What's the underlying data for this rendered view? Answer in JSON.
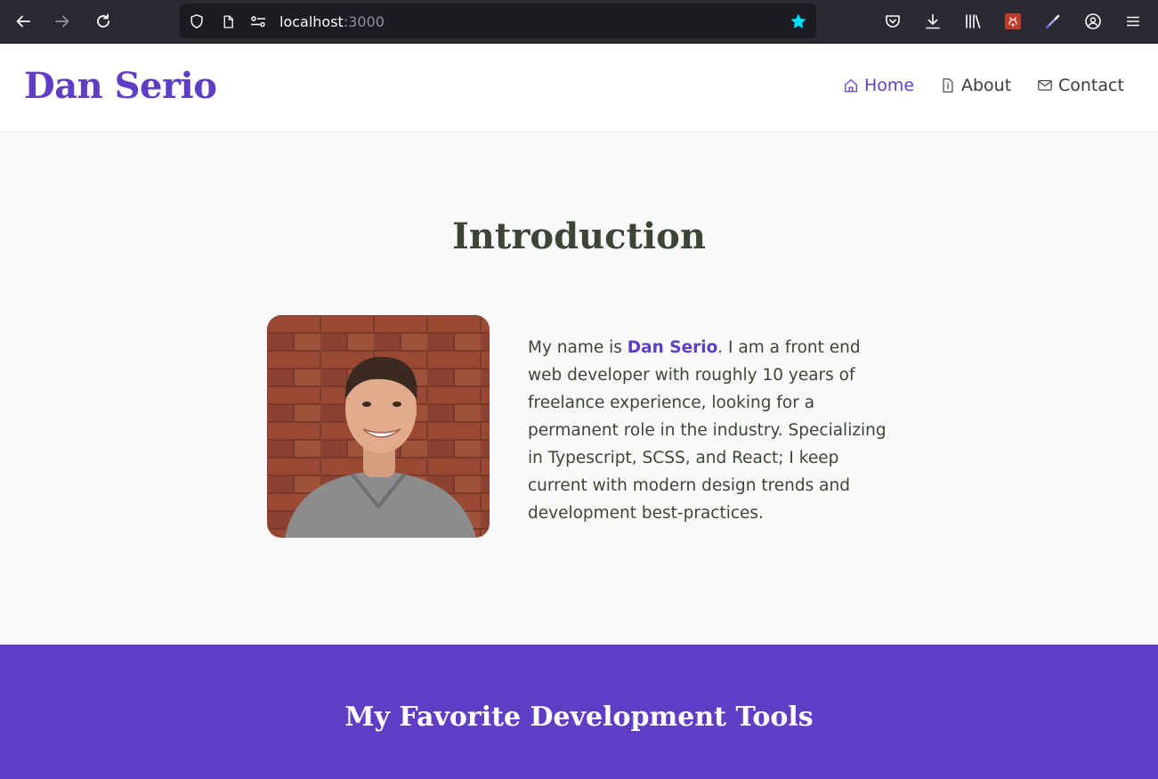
{
  "browser": {
    "url_host": "localhost",
    "url_port": ":3000",
    "icons": {
      "back": "back-arrow-icon",
      "forward": "forward-arrow-icon",
      "reload": "reload-icon",
      "shield": "tracking-protection-shield-icon",
      "page": "page-info-icon",
      "permissions": "permissions-icon",
      "bookmark": "bookmark-star-icon",
      "pocket": "pocket-icon",
      "downloads": "download-icon",
      "library": "library-icon",
      "extension1": "extension-icon",
      "extension2": "eyedropper-icon",
      "sync": "account-sync-icon",
      "menu": "hamburger-menu-icon"
    },
    "accent": "#00ddff"
  },
  "site": {
    "logo": "Dan Serio",
    "brand_color": "#5f3dc4",
    "nav": [
      {
        "label": "Home",
        "icon": "home-icon",
        "active": true
      },
      {
        "label": "About",
        "icon": "document-icon",
        "active": false
      },
      {
        "label": "Contact",
        "icon": "mail-icon",
        "active": false
      }
    ]
  },
  "intro": {
    "title": "Introduction",
    "text_before": "My name is ",
    "name": "Dan Serio",
    "text_after": ". I am a front end web developer with roughly 10 years of freelance experience, looking for a permanent role in the industry. Specializing in Typescript, SCSS, and React; I keep current with modern design trends and development best-practices.",
    "photo": "profile-photo"
  },
  "tools": {
    "title": "My Favorite Development Tools"
  }
}
